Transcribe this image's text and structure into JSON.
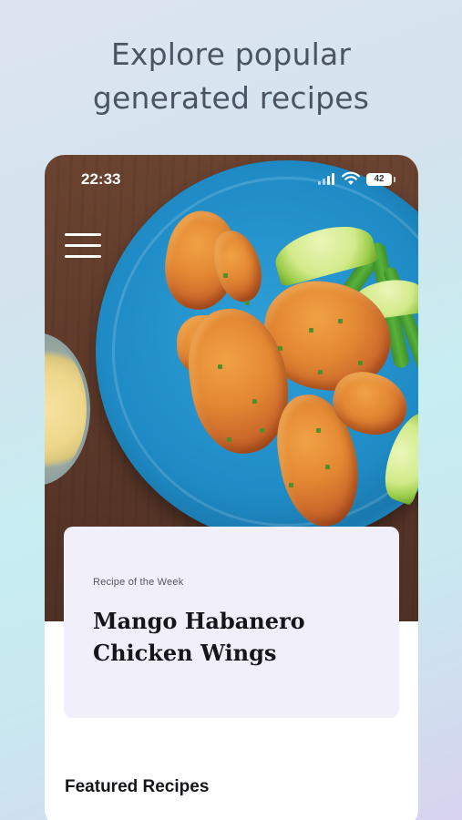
{
  "headline": {
    "line1": "Explore popular",
    "line2": "generated recipes"
  },
  "status_bar": {
    "time": "22:33",
    "battery": "42",
    "icons": [
      "signal-icon",
      "wifi-icon",
      "battery-icon"
    ]
  },
  "hero": {
    "menu_icon": "hamburger-menu-icon"
  },
  "featured_card": {
    "eyebrow": "Recipe of the Week",
    "title_line1": "Mango Habanero",
    "title_line2": "Chicken Wings"
  },
  "section": {
    "title": "Featured Recipes"
  },
  "colors": {
    "card_background": "#f1f0fa",
    "plate": "#1f8bc6",
    "text_dark": "#15151a",
    "headline_text": "#4c5463"
  }
}
